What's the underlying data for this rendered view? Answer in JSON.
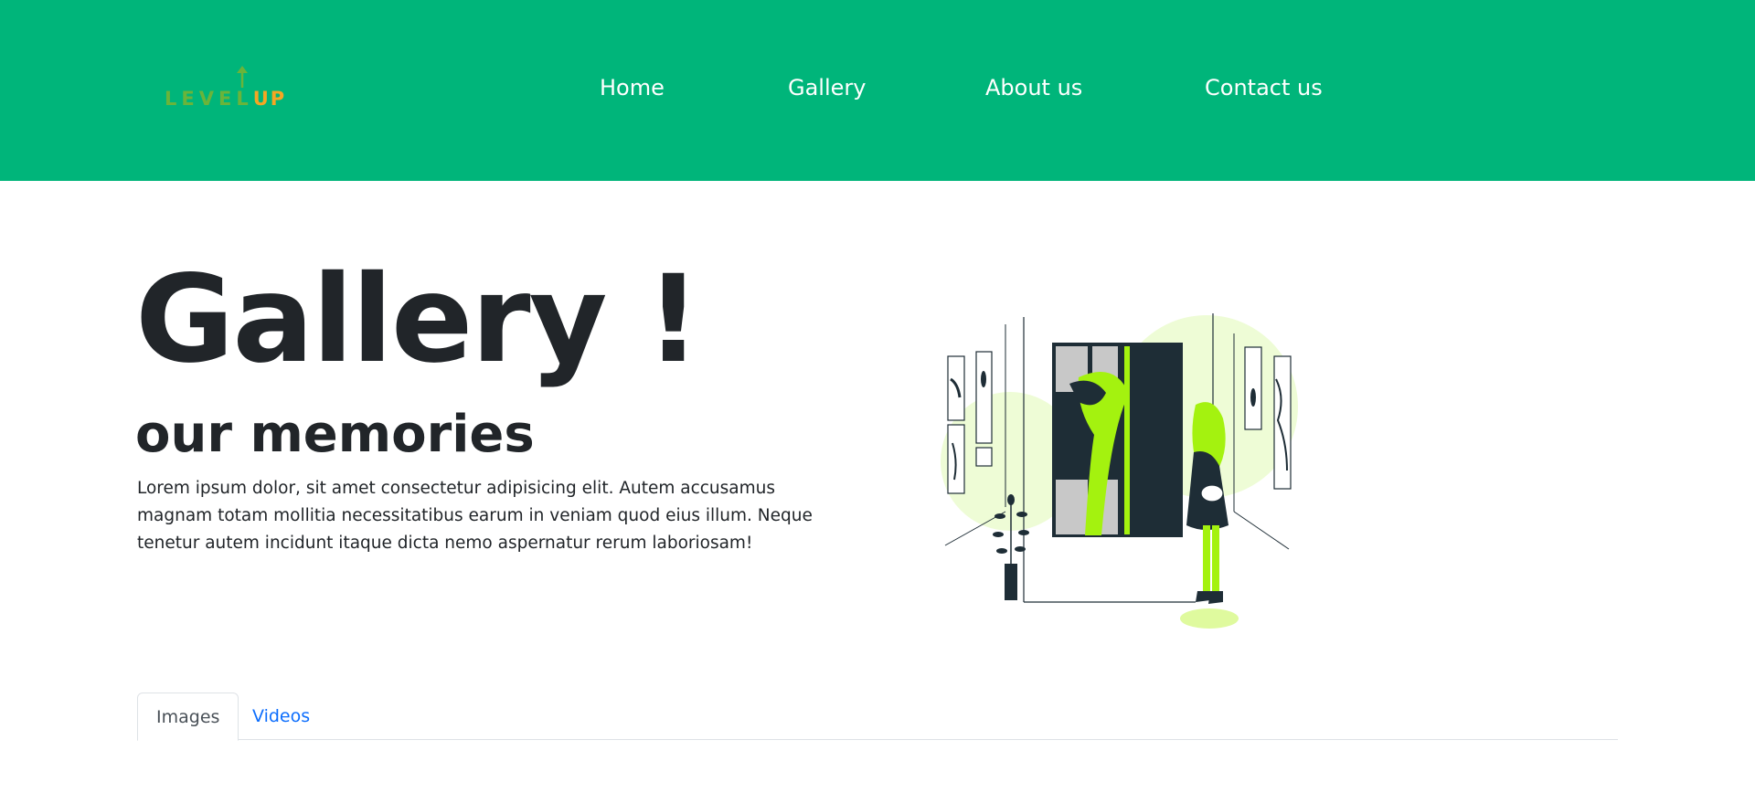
{
  "brand": {
    "logo_level": "LEVEL",
    "logo_up": "UP",
    "primary_color": "#00b57a",
    "logo_green": "#6ab43a",
    "logo_orange": "#f5a623"
  },
  "nav": {
    "items": [
      {
        "label": "Home"
      },
      {
        "label": "Gallery"
      },
      {
        "label": "About us"
      },
      {
        "label": "Contact us"
      }
    ]
  },
  "hero": {
    "title": "Gallery !",
    "subtitle": "our memories",
    "text": "Lorem ipsum dolor, sit amet consectetur adipisicing elit. Autem accusamus magnam totam mollitia necessitatibus earum in veniam quod eius illum. Neque tenetur autem incidunt itaque dicta nemo aspernatur rerum laboriosam!",
    "accent_color": "#a4f20f"
  },
  "tabs": {
    "items": [
      {
        "label": "Images",
        "active": true
      },
      {
        "label": "Videos",
        "active": false
      }
    ]
  }
}
